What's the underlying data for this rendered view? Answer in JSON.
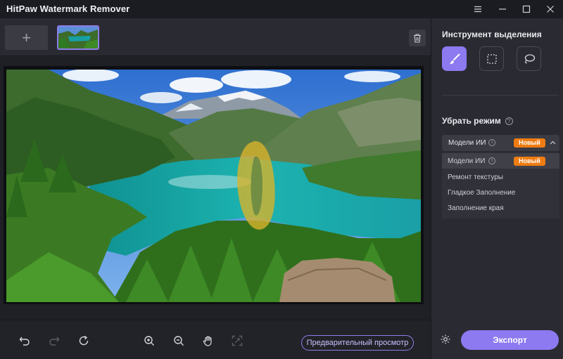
{
  "app": {
    "title": "HitPaw Watermark Remover"
  },
  "window_controls": [
    "menu-icon",
    "minimize-icon",
    "maximize-icon",
    "close-icon"
  ],
  "thumbnails": {
    "add_label": "+",
    "selected_index": 0
  },
  "toolbar_icons": [
    "undo-icon",
    "redo-icon",
    "reset-icon",
    "zoom-in-icon",
    "zoom-out-icon",
    "hand-icon",
    "fit-icon"
  ],
  "preview_button": "Предварительный просмотр",
  "panel": {
    "selection_tool_title": "Инструмент выделения",
    "selection_tools": [
      "brush-icon",
      "rectangle-select-icon",
      "lasso-icon"
    ],
    "active_tool": "brush-icon",
    "remove_mode_title": "Убрать режим",
    "dropdown": {
      "selected": "Модели ИИ",
      "badge": "Новый"
    },
    "modes": [
      {
        "label": "Модели ИИ",
        "badge": "Новый"
      },
      {
        "label": "Ремонт текстуры"
      },
      {
        "label": "Гладкое Заполнение"
      },
      {
        "label": "Заполнение края"
      }
    ]
  },
  "export_button": "Экспорт",
  "colors": {
    "accent": "#8d79f0",
    "badge": "#ef7c12",
    "bg": "#1b1c22",
    "panel": "#2a2b32"
  }
}
